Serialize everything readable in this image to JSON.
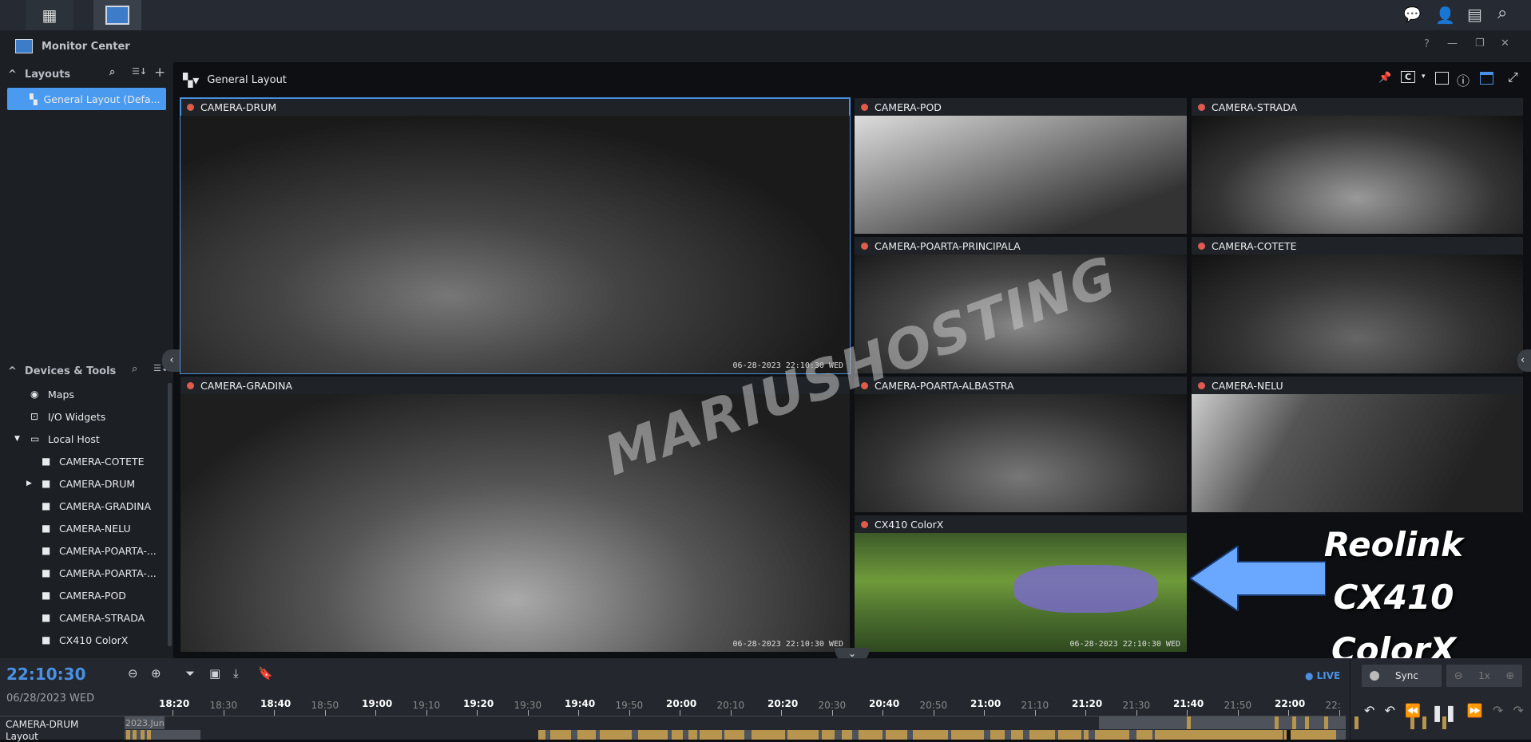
{
  "app": {
    "title": "Monitor Center"
  },
  "topbar": {
    "icons": [
      "apps-grid-icon",
      "monitor-center-icon",
      "chat-icon",
      "user-icon",
      "widgets-icon",
      "search-icon"
    ]
  },
  "window_controls": {
    "help": "?",
    "minimize": "—",
    "restore": "❐",
    "close": "✕"
  },
  "sidebar": {
    "layouts": {
      "title": "Layouts",
      "items": [
        {
          "label": "General Layout (Defa...",
          "selected": true
        }
      ]
    },
    "devices": {
      "title": "Devices & Tools",
      "items": [
        {
          "label": "Maps",
          "icon": "map-icon"
        },
        {
          "label": "I/O Widgets",
          "icon": "io-icon"
        },
        {
          "label": "Local Host",
          "icon": "host-icon",
          "expanded": true
        },
        {
          "label": "CAMERA-COTETE",
          "icon": "camera-icon"
        },
        {
          "label": "CAMERA-DRUM",
          "icon": "camera-icon"
        },
        {
          "label": "CAMERA-GRADINA",
          "icon": "camera-icon"
        },
        {
          "label": "CAMERA-NELU",
          "icon": "camera-icon"
        },
        {
          "label": "CAMERA-POARTA-...",
          "icon": "camera-icon"
        },
        {
          "label": "CAMERA-POARTA-...",
          "icon": "camera-icon"
        },
        {
          "label": "CAMERA-POD",
          "icon": "camera-icon"
        },
        {
          "label": "CAMERA-STRADA",
          "icon": "camera-icon"
        },
        {
          "label": "CX410 ColorX",
          "icon": "camera-icon"
        }
      ]
    }
  },
  "main": {
    "layout_name": "General Layout",
    "cameras": [
      {
        "name": "CAMERA-DRUM",
        "timestamp": "06-28-2023 22:10:30 WED",
        "selected": true
      },
      {
        "name": "CAMERA-POD",
        "timestamp": ""
      },
      {
        "name": "CAMERA-STRADA",
        "timestamp": ""
      },
      {
        "name": "CAMERA-POARTA-PRINCIPALA",
        "timestamp": ""
      },
      {
        "name": "CAMERA-COTETE",
        "timestamp": ""
      },
      {
        "name": "CAMERA-GRADINA",
        "timestamp": "06-28-2023 22:10:30 WED"
      },
      {
        "name": "CAMERA-POARTA-ALBASTRA",
        "timestamp": ""
      },
      {
        "name": "CAMERA-NELU",
        "timestamp": ""
      },
      {
        "name": "CX410 ColorX",
        "timestamp": "06-28-2023 22:10:30 WED"
      }
    ],
    "overlay_text": [
      "Reolink CX410",
      "ColorX"
    ],
    "watermark": "MARIUSHOSTING",
    "accent": "#4a90e2",
    "arrow_color": "#6aa8ff"
  },
  "timeline": {
    "time": "22:10:30",
    "date": "06/28/2023 WED",
    "live": "LIVE",
    "ticks": [
      "18:20",
      "18:30",
      "18:40",
      "18:50",
      "19:00",
      "19:10",
      "19:20",
      "19:30",
      "19:40",
      "19:50",
      "20:00",
      "20:10",
      "20:20",
      "20:30",
      "20:40",
      "20:50",
      "21:00",
      "21:10",
      "21:20",
      "21:30",
      "21:40",
      "21:50",
      "22:00",
      "22:"
    ],
    "rows": [
      "CAMERA-DRUM",
      "Layout"
    ],
    "month_label": "2023.Jun",
    "sync": "Sync",
    "speed": "1x",
    "recording_color": "#b8954f"
  }
}
